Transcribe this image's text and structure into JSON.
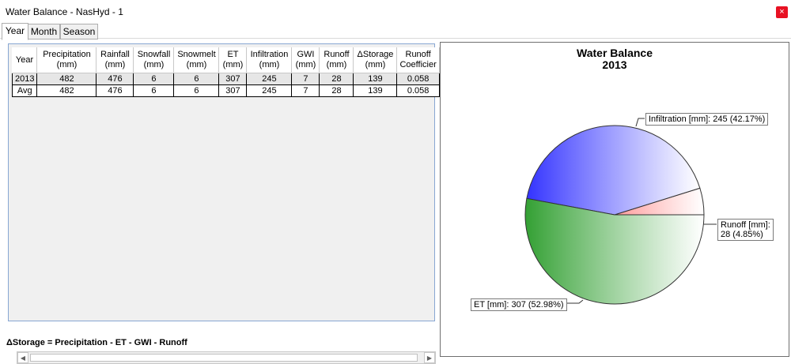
{
  "window": {
    "title": "Water Balance - NasHyd - 1",
    "close_glyph": "×"
  },
  "tabs": [
    {
      "label": "Year"
    },
    {
      "label": "Month"
    },
    {
      "label": "Season"
    }
  ],
  "table": {
    "headers": [
      {
        "l1": "Year",
        "l2": ""
      },
      {
        "l1": "Precipitation",
        "l2": "(mm)"
      },
      {
        "l1": "Rainfall",
        "l2": "(mm)"
      },
      {
        "l1": "Snowfall",
        "l2": "(mm)"
      },
      {
        "l1": "Snowmelt",
        "l2": "(mm)"
      },
      {
        "l1": "ET",
        "l2": "(mm)"
      },
      {
        "l1": "Infiltration",
        "l2": "(mm)"
      },
      {
        "l1": "GWI",
        "l2": "(mm)"
      },
      {
        "l1": "Runoff",
        "l2": "(mm)"
      },
      {
        "l1": "ΔStorage",
        "l2": "(mm)"
      },
      {
        "l1": "Runoff",
        "l2": "Coefficier"
      }
    ],
    "rows": [
      [
        "2013",
        "482",
        "476",
        "6",
        "6",
        "307",
        "245",
        "7",
        "28",
        "139",
        "0.058"
      ],
      [
        "Avg",
        "482",
        "476",
        "6",
        "6",
        "307",
        "245",
        "7",
        "28",
        "139",
        "0.058"
      ]
    ]
  },
  "formula": "ΔStorage = Precipitation - ET - GWI - Runoff",
  "chart_data": {
    "type": "pie",
    "title": "Water Balance",
    "subtitle": "2013",
    "slices": [
      {
        "label": "Runoff [mm]: 28 (4.85%)",
        "label_lines": [
          "Runoff [mm]:",
          "28 (4.85%)"
        ],
        "value": 28,
        "percent": 4.85,
        "color": "#ff9999"
      },
      {
        "label": "Infiltration [mm]: 245 (42.17%)",
        "label_lines": [
          "Infiltration [mm]: 245 (42.17%)"
        ],
        "value": 245,
        "percent": 42.17,
        "color": "#3333ff"
      },
      {
        "label": "ET [mm]: 307 (52.98%)",
        "label_lines": [
          "ET [mm]: 307 (52.98%)"
        ],
        "value": 307,
        "percent": 52.98,
        "color": "#33a033"
      }
    ]
  }
}
